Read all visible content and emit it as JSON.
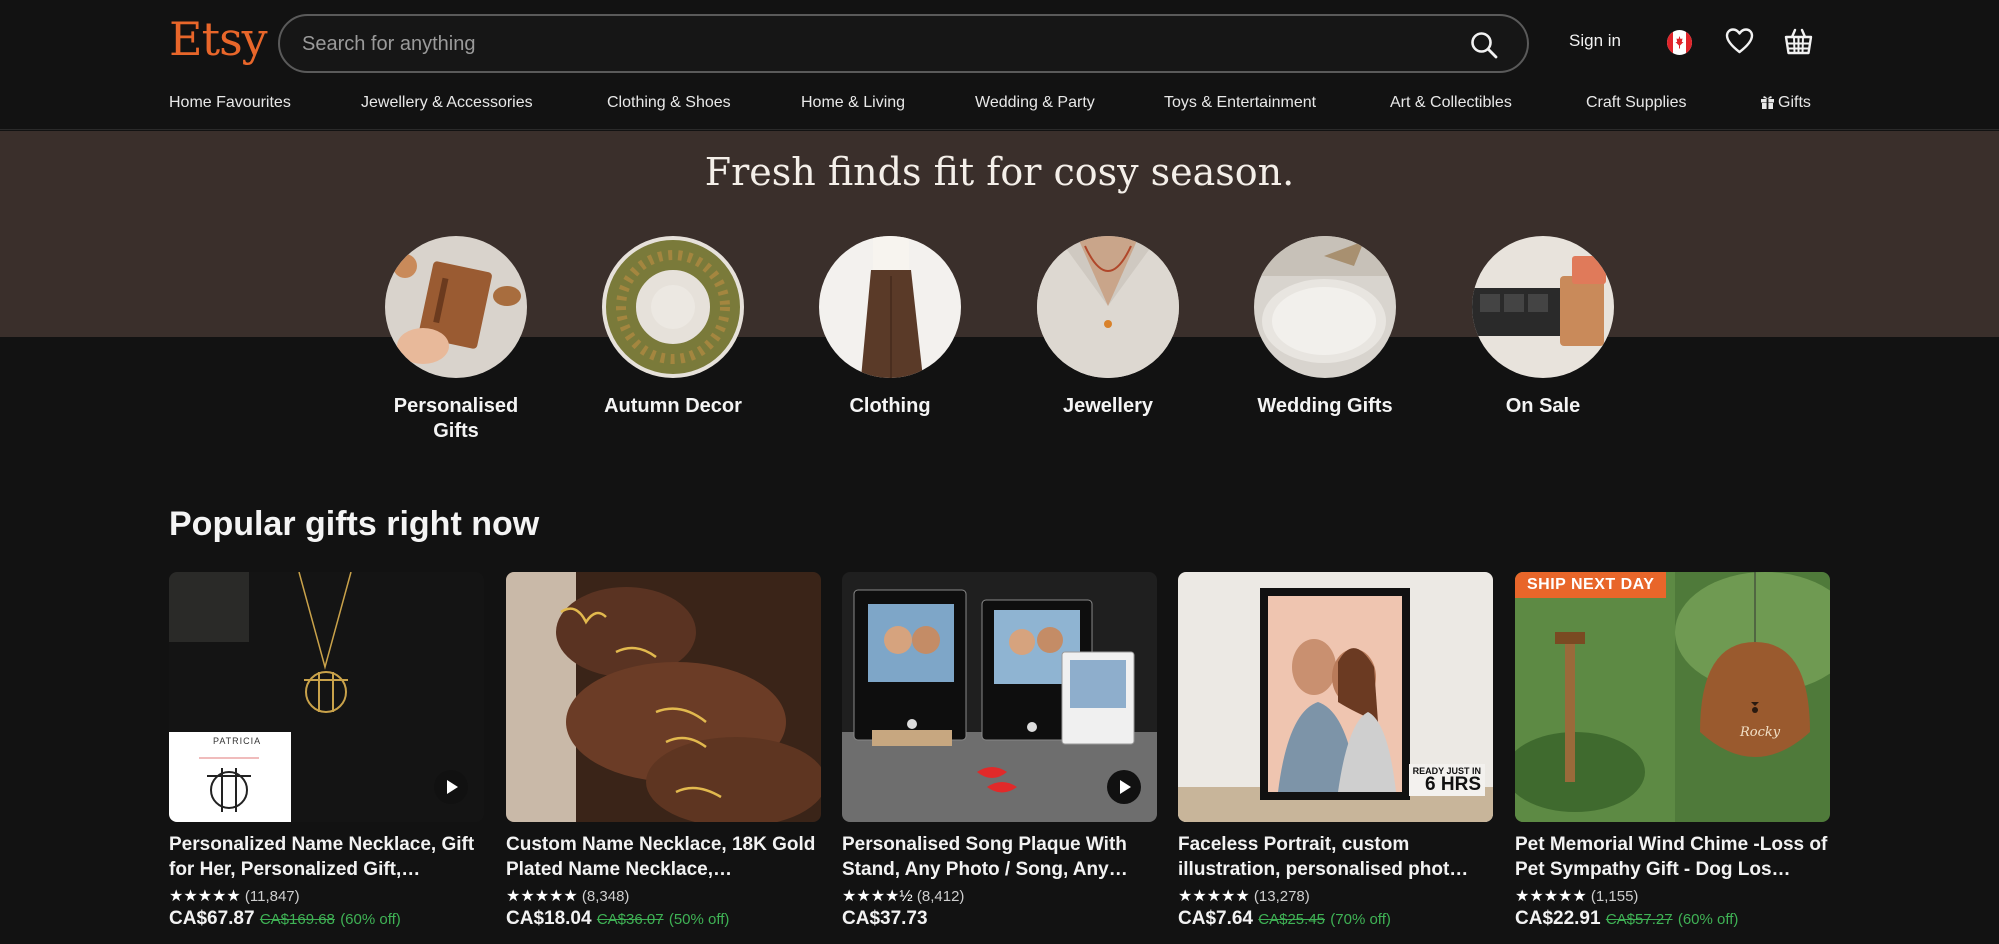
{
  "header": {
    "logo": "Etsy",
    "search_placeholder": "Search for anything",
    "signin": "Sign in"
  },
  "nav": [
    {
      "label": "Home Favourites"
    },
    {
      "label": "Jewellery & Accessories"
    },
    {
      "label": "Clothing & Shoes"
    },
    {
      "label": "Home & Living"
    },
    {
      "label": "Wedding & Party"
    },
    {
      "label": "Toys & Entertainment"
    },
    {
      "label": "Art & Collectibles"
    },
    {
      "label": "Craft Supplies"
    },
    {
      "label": "Gifts"
    }
  ],
  "hero": {
    "title": "Fresh finds fit for cosy season."
  },
  "categories": [
    {
      "label": "Personalised Gifts"
    },
    {
      "label": "Autumn Decor"
    },
    {
      "label": "Clothing"
    },
    {
      "label": "Jewellery"
    },
    {
      "label": "Wedding Gifts"
    },
    {
      "label": "On Sale"
    }
  ],
  "popular": {
    "title": "Popular gifts right now",
    "items": [
      {
        "title": "Personalized Name Necklace, Gift for Her, Personalized Gift,…",
        "stars": "★★★★★",
        "reviews": "(11,847)",
        "price": "CA$67.87",
        "old_price": "CA$169.68",
        "discount": "(60% off)",
        "image_text": "PATRICIA"
      },
      {
        "title": "Custom Name Necklace, 18K Gold Plated Name Necklace,…",
        "stars": "★★★★★",
        "reviews": "(8,348)",
        "price": "CA$18.04",
        "old_price": "CA$36.07",
        "discount": "(50% off)"
      },
      {
        "title": "Personalised Song Plaque With Stand, Any Photo / Song, Any…",
        "stars": "★★★★½",
        "reviews": "(8,412)",
        "price": "CA$37.73",
        "old_price": "",
        "discount": ""
      },
      {
        "title": "Faceless Portrait, custom illustration, personalised phot…",
        "stars": "★★★★★",
        "reviews": "(13,278)",
        "price": "CA$7.64",
        "old_price": "CA$25.45",
        "discount": "(70% off)",
        "image_text_1": "READY JUST IN",
        "image_text_2": "6 HRS"
      },
      {
        "title": "Pet Memorial Wind Chime -Loss of Pet Sympathy Gift - Dog Los…",
        "stars": "★★★★★",
        "reviews": "(1,155)",
        "price": "CA$22.91",
        "old_price": "CA$57.27",
        "discount": "(60% off)",
        "badge": "SHIP NEXT DAY",
        "image_text": "Rocky"
      }
    ]
  },
  "colors": {
    "brand": "#e8662a",
    "discount": "#3fb255",
    "hero_band": "#3a2f2b"
  }
}
